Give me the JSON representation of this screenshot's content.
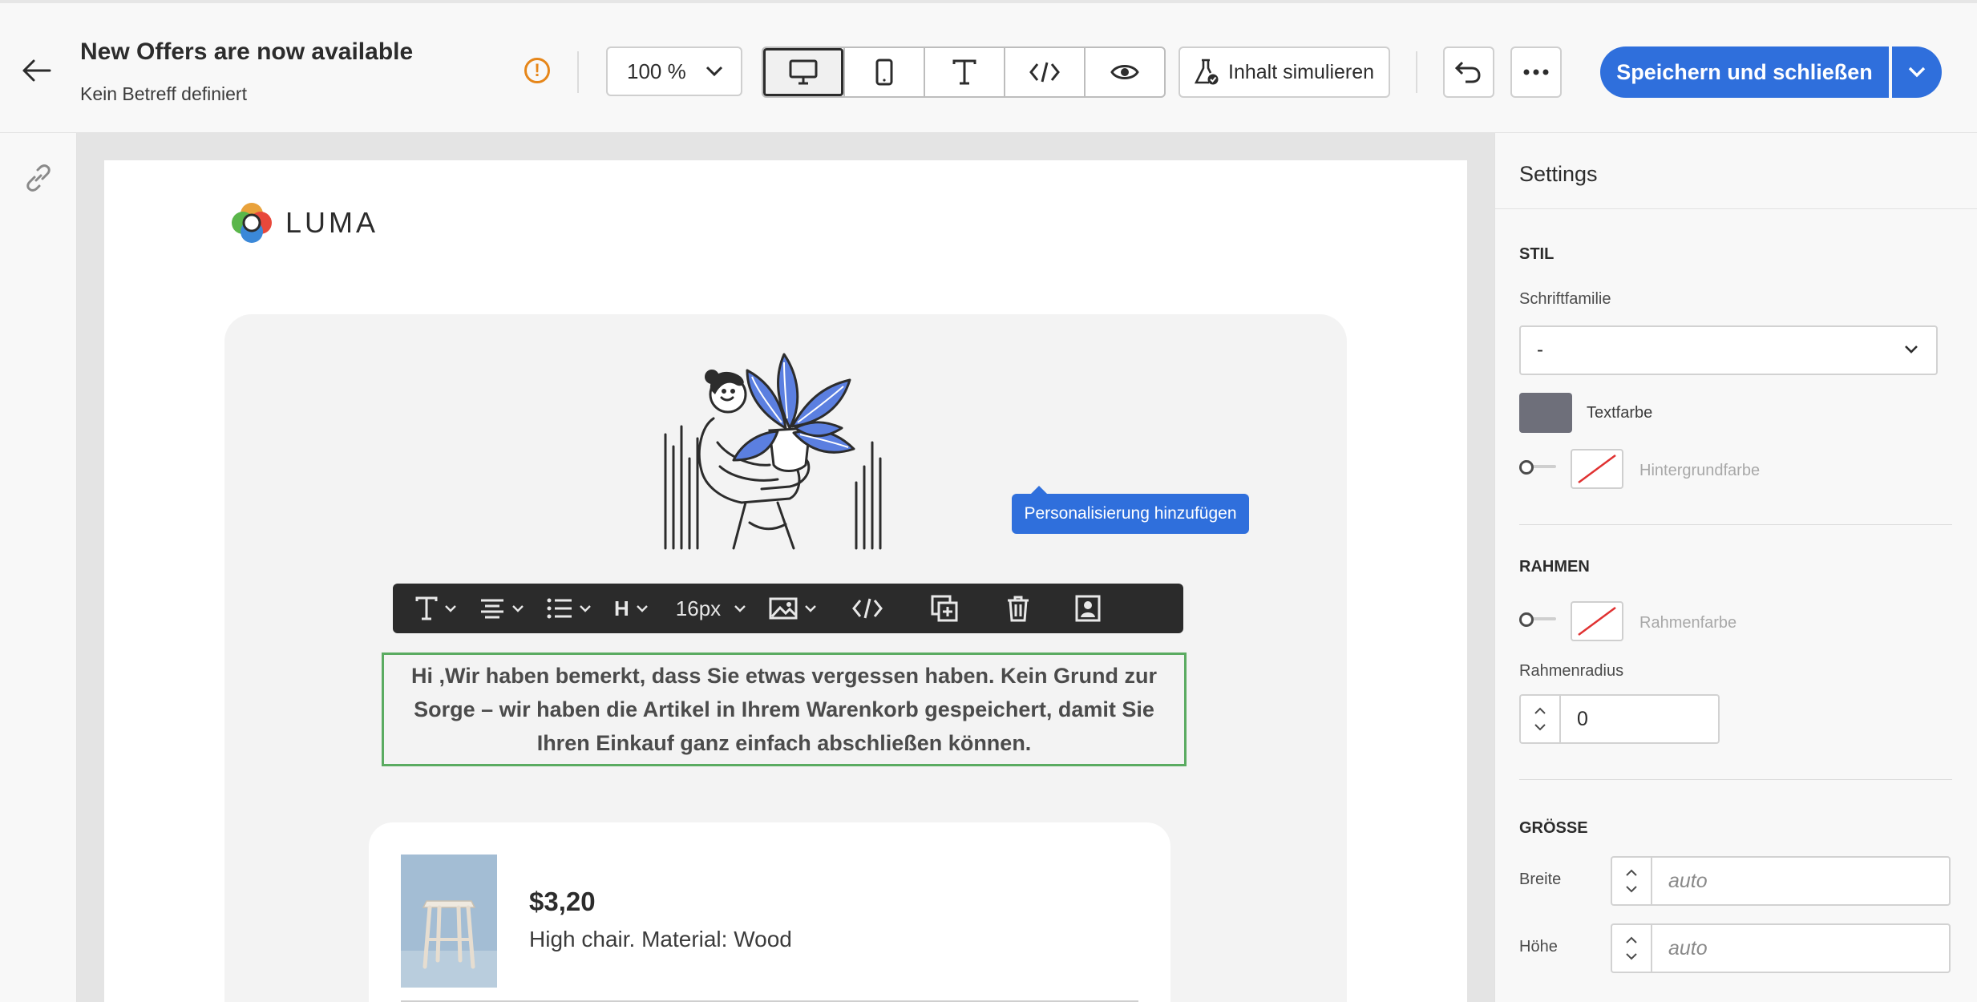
{
  "header": {
    "title": "New Offers are now available",
    "subtitle": "Kein Betreff definiert",
    "zoom": "100 %",
    "simulate_label": "Inhalt simulieren",
    "save_label": "Speichern und schließen"
  },
  "toolbar": {
    "heading_label": "H",
    "font_size": "16px"
  },
  "tooltip": "Personalisierung hinzufügen",
  "email": {
    "logo_text": "LUMA",
    "body_text": "Hi ,Wir haben bemerkt, dass Sie etwas vergessen haben. Kein Grund zur Sorge – wir haben die Artikel in Ihrem Warenkorb gespeichert, damit Sie Ihren Einkauf ganz einfach abschließen können.",
    "product": {
      "price": "$3,20",
      "description": "High chair. Material: Wood"
    }
  },
  "settings": {
    "title": "Settings",
    "style_section": "STIL",
    "font_family_label": "Schriftfamilie",
    "font_family_value": "-",
    "text_color_label": "Textfarbe",
    "text_color": "#6e6f7a",
    "bg_color_label": "Hintergrundfarbe",
    "border_section": "RAHMEN",
    "border_color_label": "Rahmenfarbe",
    "border_radius_label": "Rahmenradius",
    "border_radius_value": "0",
    "size_section": "GRÖSSE",
    "width_label": "Breite",
    "width_placeholder": "auto",
    "height_label": "Höhe",
    "height_placeholder": "auto"
  },
  "colors": {
    "accent": "#2f6fdc",
    "selection_border": "#5aab61",
    "warning": "#e68619"
  }
}
